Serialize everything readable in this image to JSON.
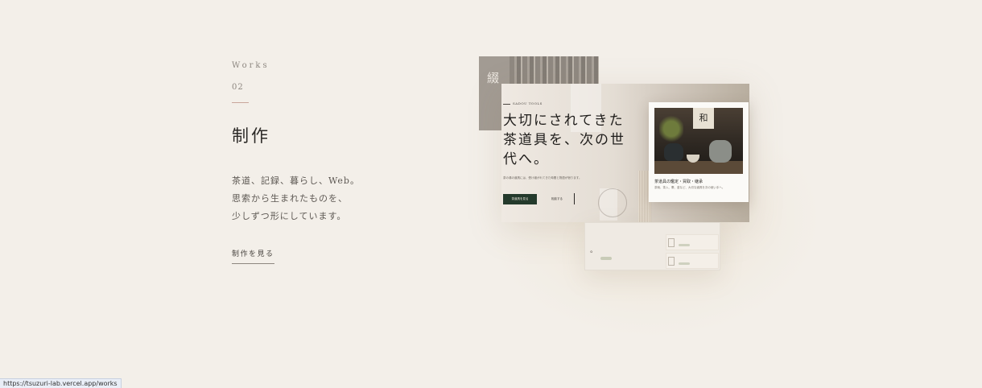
{
  "section": {
    "eyebrow": "Works",
    "number": "02",
    "title": "制作",
    "description": [
      "茶道、記録、暮らし、Web。",
      "思索から生まれたものを、",
      "少しずつ形にしています。"
    ],
    "cta": "制作を見る"
  },
  "preview": {
    "mini_kanji": "綴",
    "tag": "SADOU TOOLS",
    "headline": "大切にされてきた茶道具を、次の世代へ。",
    "body": "茶の湯の道具には、受け継がれてきた時間と物語が宿ります。",
    "primary_button": "茶道具を見る",
    "secondary_link": "相談する",
    "product_kanji": "和",
    "product_title": "茶道具の鑑定・買取・継承",
    "product_text": "茶碗、茶入、棗、釜など、大切な道具を次の使い手へ。"
  },
  "status_url": "https://tsuzuri-lab.vercel.app/works",
  "colors": {
    "background": "#f3efe9",
    "accent_rule": "#c9a69a",
    "primary_button": "#243a2c"
  }
}
